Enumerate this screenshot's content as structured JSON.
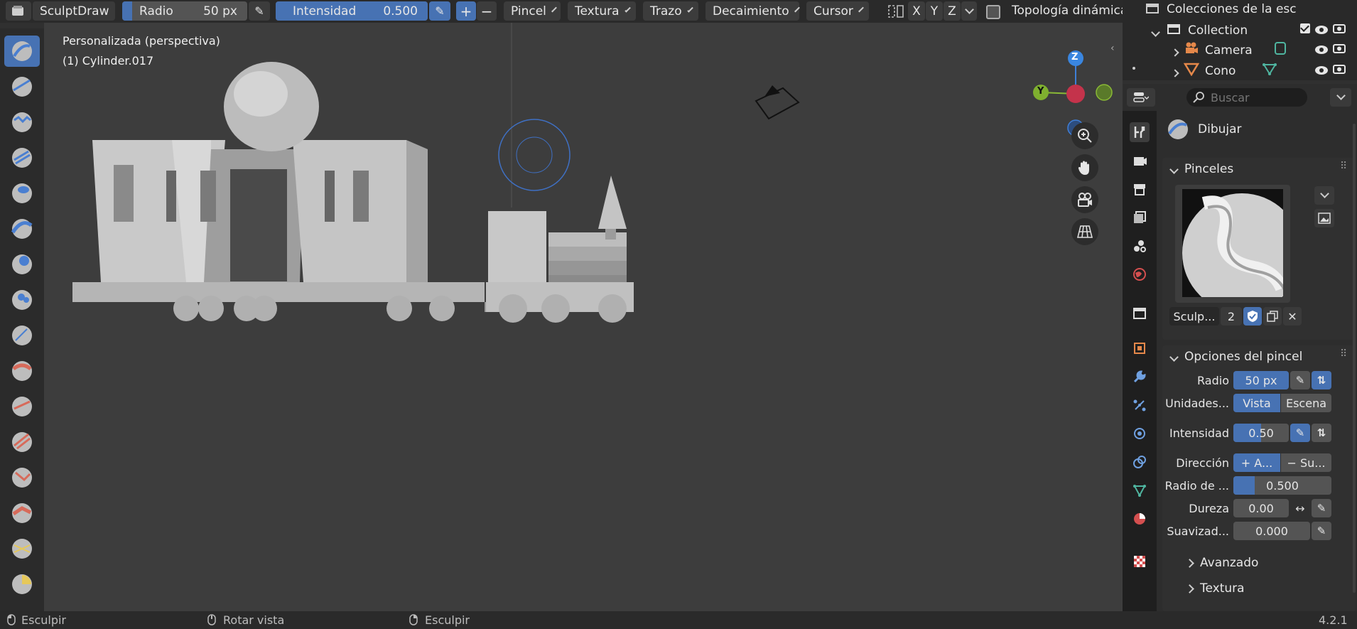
{
  "header": {
    "mode_label": "SculptDraw",
    "radius_label": "Radio",
    "radius_value": "50 px",
    "strength_label": "Intensidad",
    "strength_value": "0.500",
    "menus": [
      "Pincel",
      "Textura",
      "Trazo",
      "Decaimiento",
      "Cursor"
    ],
    "axes": [
      "X",
      "Y",
      "Z"
    ],
    "dyntopo_label": "Topología dinámica"
  },
  "viewport": {
    "view_name": "Personalizada (perspectiva)",
    "object_name": "(1) Cylinder.017",
    "gizmo": {
      "x": "X",
      "y": "Y",
      "z": "Z"
    }
  },
  "outliner": {
    "title": "Colecciones de la esc",
    "collection": "Collection",
    "items": [
      "Camera",
      "Cono"
    ]
  },
  "properties": {
    "search_placeholder": "Buscar",
    "tool_name": "Dibujar",
    "brushes_title": "Pinceles",
    "brush_name": "Sculp...",
    "brush_users": "2",
    "brush_options_title": "Opciones del pincel",
    "radius_label": "Radio",
    "radius_value": "50 px",
    "units_label": "Unidades...",
    "units_view": "Vista",
    "units_scene": "Escena",
    "strength_label": "Intensidad",
    "strength_value": "0.50",
    "direction_label": "Dirección",
    "direction_add": "+ A...",
    "direction_sub": "− Su...",
    "normal_radius_label": "Radio de ...",
    "normal_radius_value": "0.500",
    "hardness_label": "Dureza",
    "hardness_value": "0.00",
    "autosmooth_label": "Suavizad...",
    "autosmooth_value": "0.000",
    "advanced_label": "Avanzado",
    "texture_label": "Textura"
  },
  "status": {
    "left_action": "Esculpir",
    "middle_action": "Rotar vista",
    "right_action": "Esculpir",
    "version": "4.2.1"
  },
  "colors": {
    "accent": "#4772b3",
    "header_bg": "#2a2a2a",
    "viewport_bg": "#3d3d3d",
    "panel_bg": "#303030"
  }
}
